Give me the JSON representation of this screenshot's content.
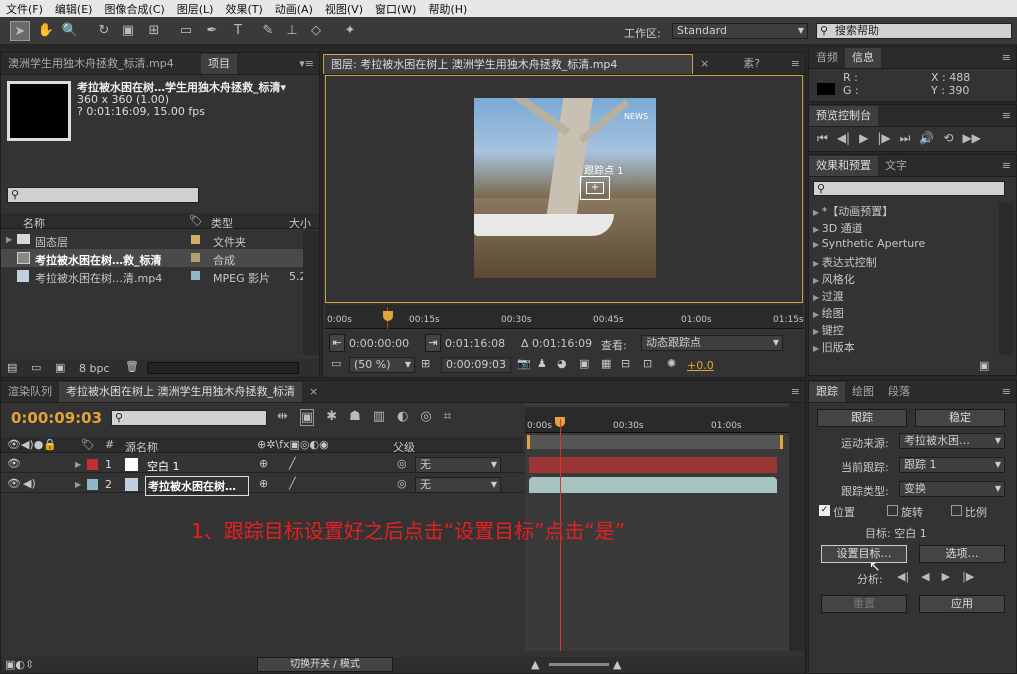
{
  "menu": [
    "文件(F)",
    "编辑(E)",
    "图像合成(C)",
    "图层(L)",
    "效果(T)",
    "动画(A)",
    "视图(V)",
    "窗口(W)",
    "帮助(H)"
  ],
  "toolbar": {
    "workspace_label": "工作区:",
    "workspace_value": "Standard",
    "search_help": "搜索帮助"
  },
  "project": {
    "tab_source": "澳洲学生用独木舟拯救_标清.mp4",
    "tab_project": "项目",
    "comp_name": "考拉被水困在树…学生用独木舟拯救_标清▾",
    "comp_size": "360 x 360 (1.00)",
    "comp_duration": "? 0:01:16:09, 15.00 fps",
    "col_name": "名称",
    "col_type": "类型",
    "col_size": "大小",
    "rows": [
      {
        "name": "固态层",
        "type": "文件夹",
        "size": "",
        "color": "#d0b060"
      },
      {
        "name": "考拉被水困在树…救_标清",
        "type": "合成",
        "size": "",
        "color": "#b0a070"
      },
      {
        "name": "考拉被水困在树…清.mp4",
        "type": "MPEG 影片",
        "size": "5.2",
        "color": "#90b8c8"
      }
    ],
    "bpc": "8 bpc"
  },
  "viewer": {
    "tab": "图层: 考拉被水困在树上 澳洲学生用独木舟拯救_标清.mp4",
    "tab2": "素?",
    "track_label": "跟踪点 1",
    "news": "NEWS",
    "ticks": [
      "0:00s",
      "00:15s",
      "00:30s",
      "00:45s",
      "01:00s",
      "01:15s"
    ],
    "time_in": "0:00:00:00",
    "time_out": "0:01:16:08",
    "duration": "Δ 0:01:16:09",
    "view_label": "查看:",
    "view_value": "动态跟踪点",
    "zoom": "(50 %)",
    "current_time": "0:00:09:03",
    "exposure": "+0.0"
  },
  "info": {
    "tab1": "音频",
    "tab2": "信息",
    "r_label": "R :",
    "g_label": "G :",
    "x_val": "X : 488",
    "y_val": "Y : 390"
  },
  "preview": {
    "tab": "预览控制台"
  },
  "effects": {
    "tab1": "效果和预置",
    "tab2": "文字",
    "items": [
      "*【动画预置】",
      "3D 通道",
      "Synthetic Aperture",
      "表达式控制",
      "风格化",
      "过渡",
      "绘图",
      "键控",
      "旧版本"
    ]
  },
  "timeline": {
    "tab1": "渲染队列",
    "tab2": "考拉被水困在树上 澳洲学生用独木舟拯救_标清",
    "time": "0:00:09:03",
    "col_source": "源名称",
    "col_parent": "父级",
    "ticks": [
      "0:00s",
      "00:30s",
      "01:00s"
    ],
    "layers": [
      {
        "num": "1",
        "name": "空白 1",
        "parent": "无",
        "color": "#c03030",
        "bar": "#9a3535"
      },
      {
        "num": "2",
        "name": "考拉被水困在树…",
        "parent": "无",
        "color": "#90b8c8",
        "bar": "#a8c4c0"
      }
    ],
    "switch_label": "切换开关 / 模式",
    "annotation": "1、跟踪目标设置好之后点击“设置目标”点击“是”"
  },
  "tracker": {
    "tab1": "跟踪",
    "tab2": "绘图",
    "tab3": "段落",
    "btn_track": "跟踪",
    "btn_stabilize": "稳定",
    "motion_source_label": "运动来源:",
    "motion_source": "考拉被水困…",
    "current_track_label": "当前跟踪:",
    "current_track": "跟踪 1",
    "track_type_label": "跟踪类型:",
    "track_type": "变换",
    "cb_position": "位置",
    "cb_rotation": "旋转",
    "cb_scale": "比例",
    "target": "目标: 空白 1",
    "btn_set_target": "设置目标…",
    "btn_options": "选项…",
    "analyze_label": "分析:",
    "btn_reset": "重置",
    "btn_apply": "应用"
  }
}
